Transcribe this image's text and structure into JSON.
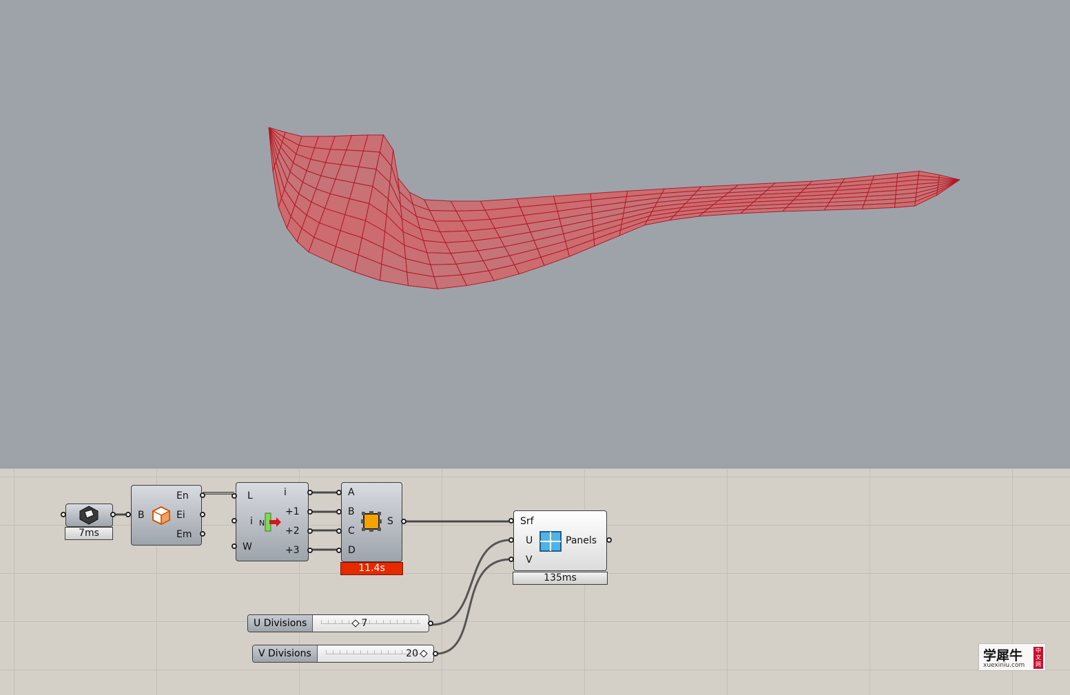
{
  "viewport": {
    "background": "#9ea3aa",
    "surface_color": "#cd6b6f",
    "mesh_line_color": "#b01a25"
  },
  "nodes": {
    "brep_param": {
      "icon": "brep-param-icon",
      "timer": "7ms"
    },
    "deconstruct_brep": {
      "icon": "deconstruct-brep-icon",
      "inputs": [
        "B"
      ],
      "outputs": [
        "En",
        "Ei",
        "Em"
      ]
    },
    "list_item": {
      "icon": "list-item-icon",
      "inputs": [
        "L",
        "i",
        "W"
      ],
      "outputs": [
        "i",
        "+1",
        "+2",
        "+3"
      ],
      "icon_text": "N"
    },
    "edge_surface": {
      "icon": "edge-surface-icon",
      "inputs": [
        "A",
        "B",
        "C",
        "D"
      ],
      "outputs": [
        "S"
      ],
      "timer": "11.4s",
      "timer_color": "#e52a00"
    },
    "panels": {
      "icon": "panels-icon",
      "inputs": [
        "Srf",
        "U",
        "V"
      ],
      "outputs": [
        "Panels"
      ],
      "timer": "135ms"
    }
  },
  "sliders": [
    {
      "label": "U Divisions",
      "value": "7"
    },
    {
      "label": "V Divisions",
      "value": "20"
    }
  ],
  "watermark": {
    "text": "学犀牛",
    "url": "xuexiniu.com",
    "stamp": "中文网"
  }
}
